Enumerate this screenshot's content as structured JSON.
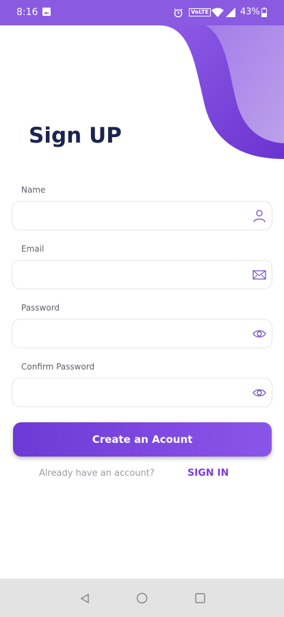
{
  "status_bar": {
    "time": "8:16",
    "volte": "VoLTE",
    "battery": "43%"
  },
  "title": "Sign UP",
  "fields": [
    {
      "label": "Name",
      "value": "",
      "icon": "user-icon"
    },
    {
      "label": "Email",
      "value": "",
      "icon": "mail-icon"
    },
    {
      "label": "Password",
      "value": "",
      "icon": "eye-icon"
    },
    {
      "label": "Confirm Password",
      "value": "",
      "icon": "eye-icon"
    }
  ],
  "create_button": "Create an Acount",
  "footer": {
    "prompt": "Already have an account?",
    "sign_in": "SIGN IN"
  },
  "nav": {
    "icons": [
      "back-icon",
      "home-icon",
      "recents-icon"
    ]
  },
  "colors": {
    "accent": "#8a55e8",
    "title": "#1d2451",
    "link": "#7c3fe0"
  }
}
